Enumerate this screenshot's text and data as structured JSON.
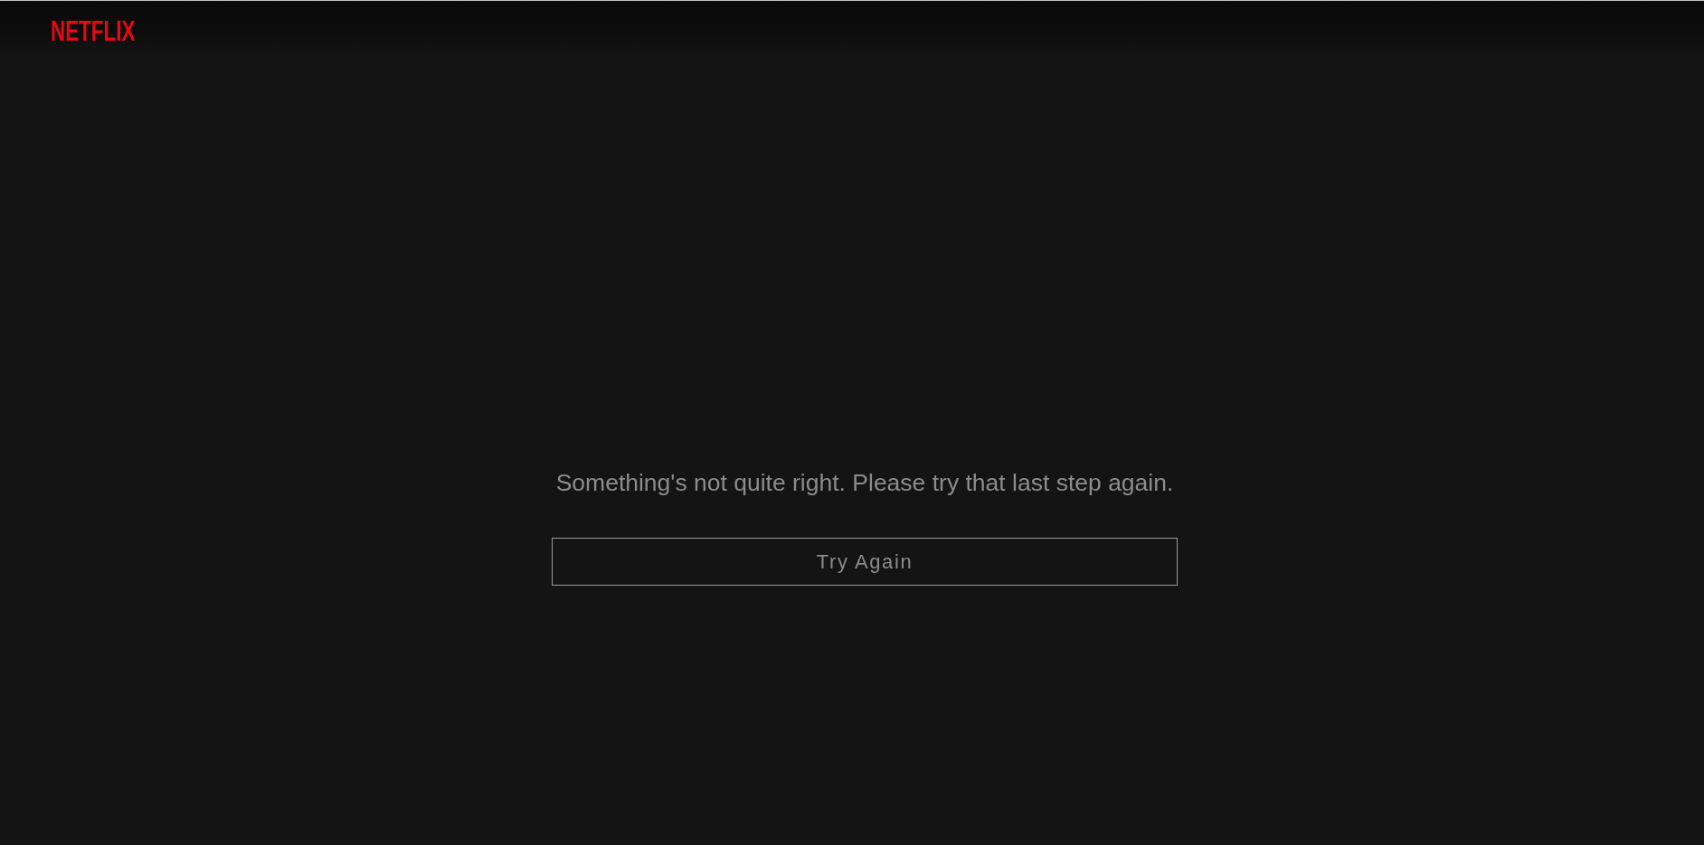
{
  "header": {
    "logo": "NETFLIX"
  },
  "message": "Something's not quite right. Please try that last step again.",
  "buttons": [
    {
      "label": "Try Again"
    }
  ]
}
